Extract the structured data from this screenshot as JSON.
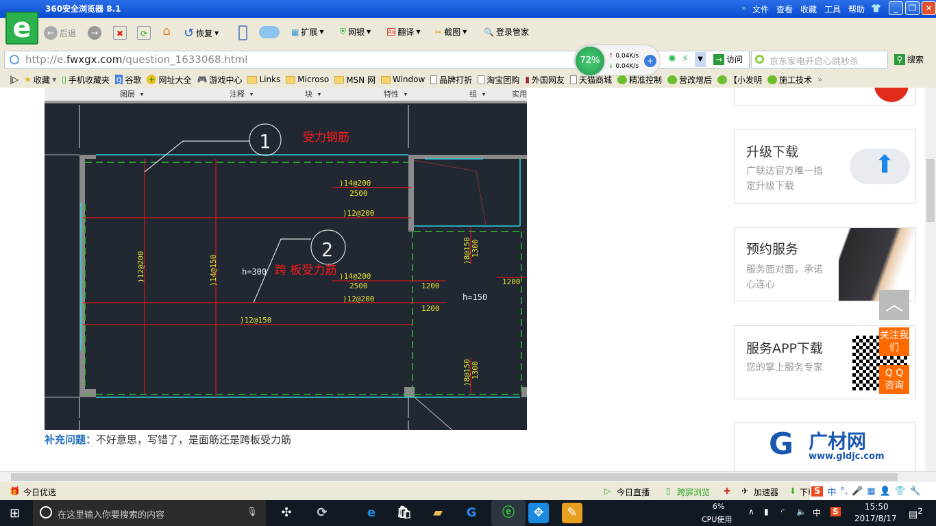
{
  "window": {
    "title": "360安全浏览器 8.1",
    "menu": [
      "文件",
      "查看",
      "收藏",
      "工具",
      "帮助"
    ]
  },
  "toolbar": {
    "back": "后退",
    "restore": "恢复",
    "extend": "扩展",
    "bank": "网银",
    "translate": "翻译",
    "screenshot": "截图",
    "login": "登录管家"
  },
  "address": {
    "prefix": "http://e.",
    "domain": "fwxgx.com",
    "path": "/question_1633068.html",
    "visit": "访问"
  },
  "speed": {
    "percent": "72%",
    "up": "0.04K/s",
    "down": "0.04K/s"
  },
  "search": {
    "placeholder": "京东家电开启心跳秒杀",
    "button": "搜索"
  },
  "bookmarks": [
    "收藏",
    "手机收藏夹",
    "谷歌",
    "网址大全",
    "游戏中心",
    "Links",
    "Microso",
    "MSN 网",
    "Window",
    "品牌打折",
    "淘宝团购",
    "外国网友",
    "天猫商城",
    "精准控制",
    "营改增后",
    "【小发明",
    "施工技术"
  ],
  "cad": {
    "ribbon": [
      "图层 ▾",
      "注释 ▾",
      "块 ▾",
      "特性 ▾",
      "组 ▾",
      "实用"
    ],
    "callout1": "1",
    "callout2": "2",
    "label_force": "受力钢筋",
    "label_span": "跨 板受力筋",
    "bars": {
      "b1": ")14@200",
      "b1_len": "2500",
      "b2": ")12@200",
      "b3": ")14@200",
      "b3_len": "2500",
      "b4": ")12@200",
      "b5": ")12@150",
      "v1": ")12@200",
      "v2": ")14@150",
      "r1": ")8@150",
      "r1_len": "1300",
      "r2": ")8@150",
      "r2_len": "1300",
      "d1": "1200",
      "d2": "1200",
      "d3": "1200"
    },
    "h1": "h=300",
    "h2": "h=150"
  },
  "note": {
    "label": "补充问题：",
    "text": "不好意思，写错了，是面筋还是跨板受力筋"
  },
  "sidebar": {
    "upgrade": {
      "title": "升级下载",
      "desc": "广联达官方唯一指定升级下载"
    },
    "service": {
      "title": "预约服务",
      "desc": "服务面对面，承诺心连心"
    },
    "app": {
      "title": "服务APP下载",
      "desc": "您的掌上服务专家"
    },
    "follow": "关注我们",
    "qq": "Q Q 咨询",
    "brand": {
      "name": "广材网",
      "url": "www.gldjc.com"
    }
  },
  "status": {
    "today": "今日优选",
    "live": "今日直播",
    "cross": "跨屏浏览",
    "accel": "加速器",
    "download": "下载"
  },
  "taskbar": {
    "search": "在这里输入你要搜索的内容",
    "cpu_pct": "6%",
    "cpu_label": "CPU使用",
    "ime": "中",
    "time": "15:50",
    "date": "2017/8/17",
    "notif": "2"
  }
}
